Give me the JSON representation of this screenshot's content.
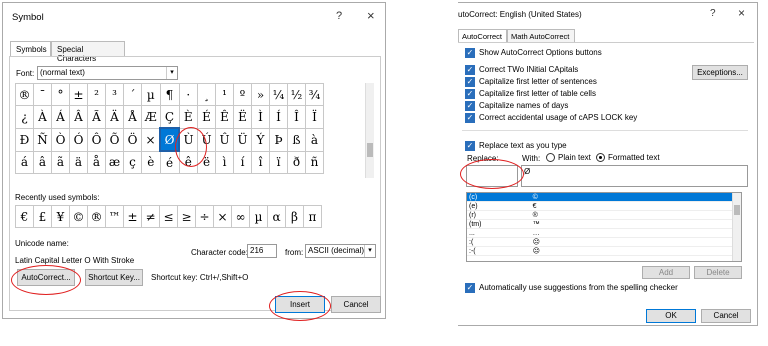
{
  "symbol_dialog": {
    "title": "Symbol",
    "help": "?",
    "close": "×",
    "tabs": [
      "Symbols",
      "Special Characters"
    ],
    "font_label": "Font:",
    "font_value": "(normal text)",
    "symbols": [
      [
        "®",
        "¯",
        "°",
        "±",
        "²",
        "³",
        "´",
        "µ",
        "¶",
        "·",
        "¸",
        "¹",
        "º",
        "»",
        "¼",
        "½",
        "¾"
      ],
      [
        "¿",
        "À",
        "Á",
        "Â",
        "Ã",
        "Ä",
        "Å",
        "Æ",
        "Ç",
        "È",
        "É",
        "Ê",
        "Ë",
        "Ì",
        "Í",
        "Î",
        "Ï"
      ],
      [
        "Ð",
        "Ñ",
        "Ò",
        "Ó",
        "Ô",
        "Õ",
        "Ö",
        "×",
        "Ø",
        "Ù",
        "Ú",
        "Û",
        "Ü",
        "Ý",
        "Þ",
        "ß",
        "à"
      ],
      [
        "á",
        "â",
        "ã",
        "ä",
        "å",
        "æ",
        "ç",
        "è",
        "é",
        "ê",
        "ë",
        "ì",
        "í",
        "î",
        "ï",
        "ð",
        "ñ"
      ]
    ],
    "recent_label": "Recently used symbols:",
    "recent": [
      "€",
      "£",
      "¥",
      "©",
      "®",
      "™",
      "±",
      "≠",
      "≤",
      "≥",
      "÷",
      "×",
      "∞",
      "µ",
      "α",
      "β",
      "π"
    ],
    "unicode_name_label": "Unicode name:",
    "unicode_name": "Latin Capital Letter O With Stroke",
    "char_code_label": "Character code:",
    "char_code": "216",
    "from_label": "from:",
    "from_value": "ASCII (decimal)",
    "autocorrect_btn": "AutoCorrect...",
    "shortcut_btn": "Shortcut Key...",
    "shortcut_text": "Shortcut key: Ctrl+/,Shift+O",
    "insert_btn": "Insert",
    "cancel_btn": "Cancel"
  },
  "autocorrect_dialog": {
    "title": "utoCorrect: English (United States)",
    "help": "?",
    "close": "×",
    "tabs": [
      "AutoCorrect",
      "Math AutoCorrect"
    ],
    "show_options": "Show AutoCorrect Options buttons",
    "checks": [
      "Correct TWo INitial CApitals",
      "Capitalize first letter of sentences",
      "Capitalize first letter of table cells",
      "Capitalize names of days",
      "Correct accidental usage of cAPS LOCK key"
    ],
    "exceptions_btn": "Exceptions...",
    "replace_as_type": "Replace text as you type",
    "replace_label": "Replace:",
    "with_label": "With:",
    "plain_text": "Plain text",
    "formatted_text": "Formatted text",
    "replace_value": "",
    "with_value": "Ø",
    "table": [
      [
        "(c)",
        "©"
      ],
      [
        "(e)",
        "€"
      ],
      [
        "(r)",
        "®"
      ],
      [
        "(tm)",
        "™"
      ],
      [
        "...",
        "…"
      ],
      [
        ":(",
        "☹"
      ],
      [
        ":-(",
        "☹"
      ]
    ],
    "add_btn": "Add",
    "delete_btn": "Delete",
    "auto_suggest": "Automatically use suggestions from the spelling checker",
    "ok_btn": "OK",
    "cancel_btn": "Cancel"
  }
}
